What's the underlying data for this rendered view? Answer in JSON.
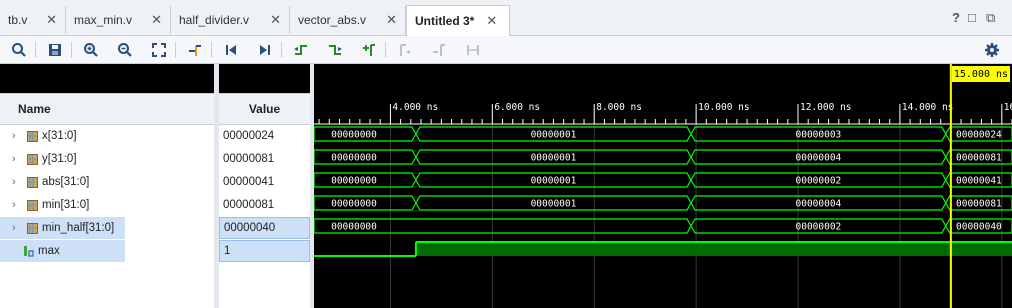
{
  "tabs": [
    {
      "label": "tb.v",
      "active": false
    },
    {
      "label": "max_min.v",
      "active": false
    },
    {
      "label": "half_divider.v",
      "active": false
    },
    {
      "label": "vector_abs.v",
      "active": false
    },
    {
      "label": "Untitled 3*",
      "active": true
    }
  ],
  "window_controls": [
    "?",
    "□",
    "⧉"
  ],
  "toolbar": {
    "buttons": [
      "search",
      "save",
      "zoom-in",
      "zoom-out",
      "zoom-fit",
      "go-to-cursor",
      "go-to-time-0",
      "go-to-last-time",
      "previous-transition",
      "next-transition",
      "add-marker",
      "previous-marker",
      "next-marker",
      "swap-cursors",
      "settings"
    ]
  },
  "columns": {
    "name": "Name",
    "value": "Value"
  },
  "signals": [
    {
      "name": "x[31:0]",
      "value": "00000024",
      "type": "bus",
      "icon": "bus-signal-icon"
    },
    {
      "name": "y[31:0]",
      "value": "00000081",
      "type": "bus",
      "icon": "bus-signal-icon"
    },
    {
      "name": "abs[31:0]",
      "value": "00000041",
      "type": "bus",
      "icon": "bus-signal-icon"
    },
    {
      "name": "min[31:0]",
      "value": "00000081",
      "type": "bus",
      "icon": "bus-signal-icon"
    },
    {
      "name": "min_half[31:0]",
      "value": "00000040",
      "type": "bus",
      "icon": "bus-signal-icon",
      "selected": true
    },
    {
      "name": "max",
      "value": "1",
      "type": "bit",
      "icon": "bit-signal-icon",
      "selected": true
    }
  ],
  "time_axis": {
    "unit": "ns",
    "visible_range_ns": [
      2.5,
      16.2
    ],
    "tick_labels": [
      "4.000 ns",
      "6.000 ns",
      "8.000 ns",
      "10.000 ns",
      "12.000 ns",
      "14.000 ns",
      "16."
    ],
    "tick_values_ns": [
      4,
      6,
      8,
      10,
      12,
      14,
      16
    ],
    "cursor_ns": 15.0,
    "cursor_label": "15.000 ns"
  },
  "waveforms": [
    {
      "signal": "x[31:0]",
      "segments": [
        {
          "start": 2.5,
          "end": 4.5,
          "value": "00000000"
        },
        {
          "start": 4.5,
          "end": 9.9,
          "value": "00000001"
        },
        {
          "start": 9.9,
          "end": 14.9,
          "value": "00000003"
        },
        {
          "start": 14.9,
          "end": 16.2,
          "value": "00000024"
        }
      ]
    },
    {
      "signal": "y[31:0]",
      "segments": [
        {
          "start": 2.5,
          "end": 4.5,
          "value": "00000000"
        },
        {
          "start": 4.5,
          "end": 9.9,
          "value": "00000001"
        },
        {
          "start": 9.9,
          "end": 14.9,
          "value": "00000004"
        },
        {
          "start": 14.9,
          "end": 16.2,
          "value": "00000081"
        }
      ]
    },
    {
      "signal": "abs[31:0]",
      "segments": [
        {
          "start": 2.5,
          "end": 4.5,
          "value": "00000000"
        },
        {
          "start": 4.5,
          "end": 9.9,
          "value": "00000001"
        },
        {
          "start": 9.9,
          "end": 14.9,
          "value": "00000002"
        },
        {
          "start": 14.9,
          "end": 16.2,
          "value": "00000041"
        }
      ]
    },
    {
      "signal": "min[31:0]",
      "segments": [
        {
          "start": 2.5,
          "end": 4.5,
          "value": "00000000"
        },
        {
          "start": 4.5,
          "end": 9.9,
          "value": "00000001"
        },
        {
          "start": 9.9,
          "end": 14.9,
          "value": "00000004"
        },
        {
          "start": 14.9,
          "end": 16.2,
          "value": "00000081"
        }
      ]
    },
    {
      "signal": "min_half[31:0]",
      "segments": [
        {
          "start": 2.5,
          "end": 9.9,
          "value": "00000000"
        },
        {
          "start": 9.9,
          "end": 14.9,
          "value": "00000002"
        },
        {
          "start": 14.9,
          "end": 16.2,
          "value": "00000040"
        }
      ]
    },
    {
      "signal": "max",
      "segments": [
        {
          "start": 2.5,
          "end": 4.5,
          "value": "0"
        },
        {
          "start": 4.5,
          "end": 9.9,
          "value": "1"
        },
        {
          "start": 9.9,
          "end": 14.9,
          "value": "1"
        },
        {
          "start": 14.9,
          "end": 16.2,
          "value": "1"
        }
      ]
    }
  ],
  "colors": {
    "wave_green": "#00ff00",
    "bit_fill": "#006b00",
    "cursor": "#ffff00",
    "grid": "#3a3a3a",
    "selected_row": "#cde0f7"
  }
}
